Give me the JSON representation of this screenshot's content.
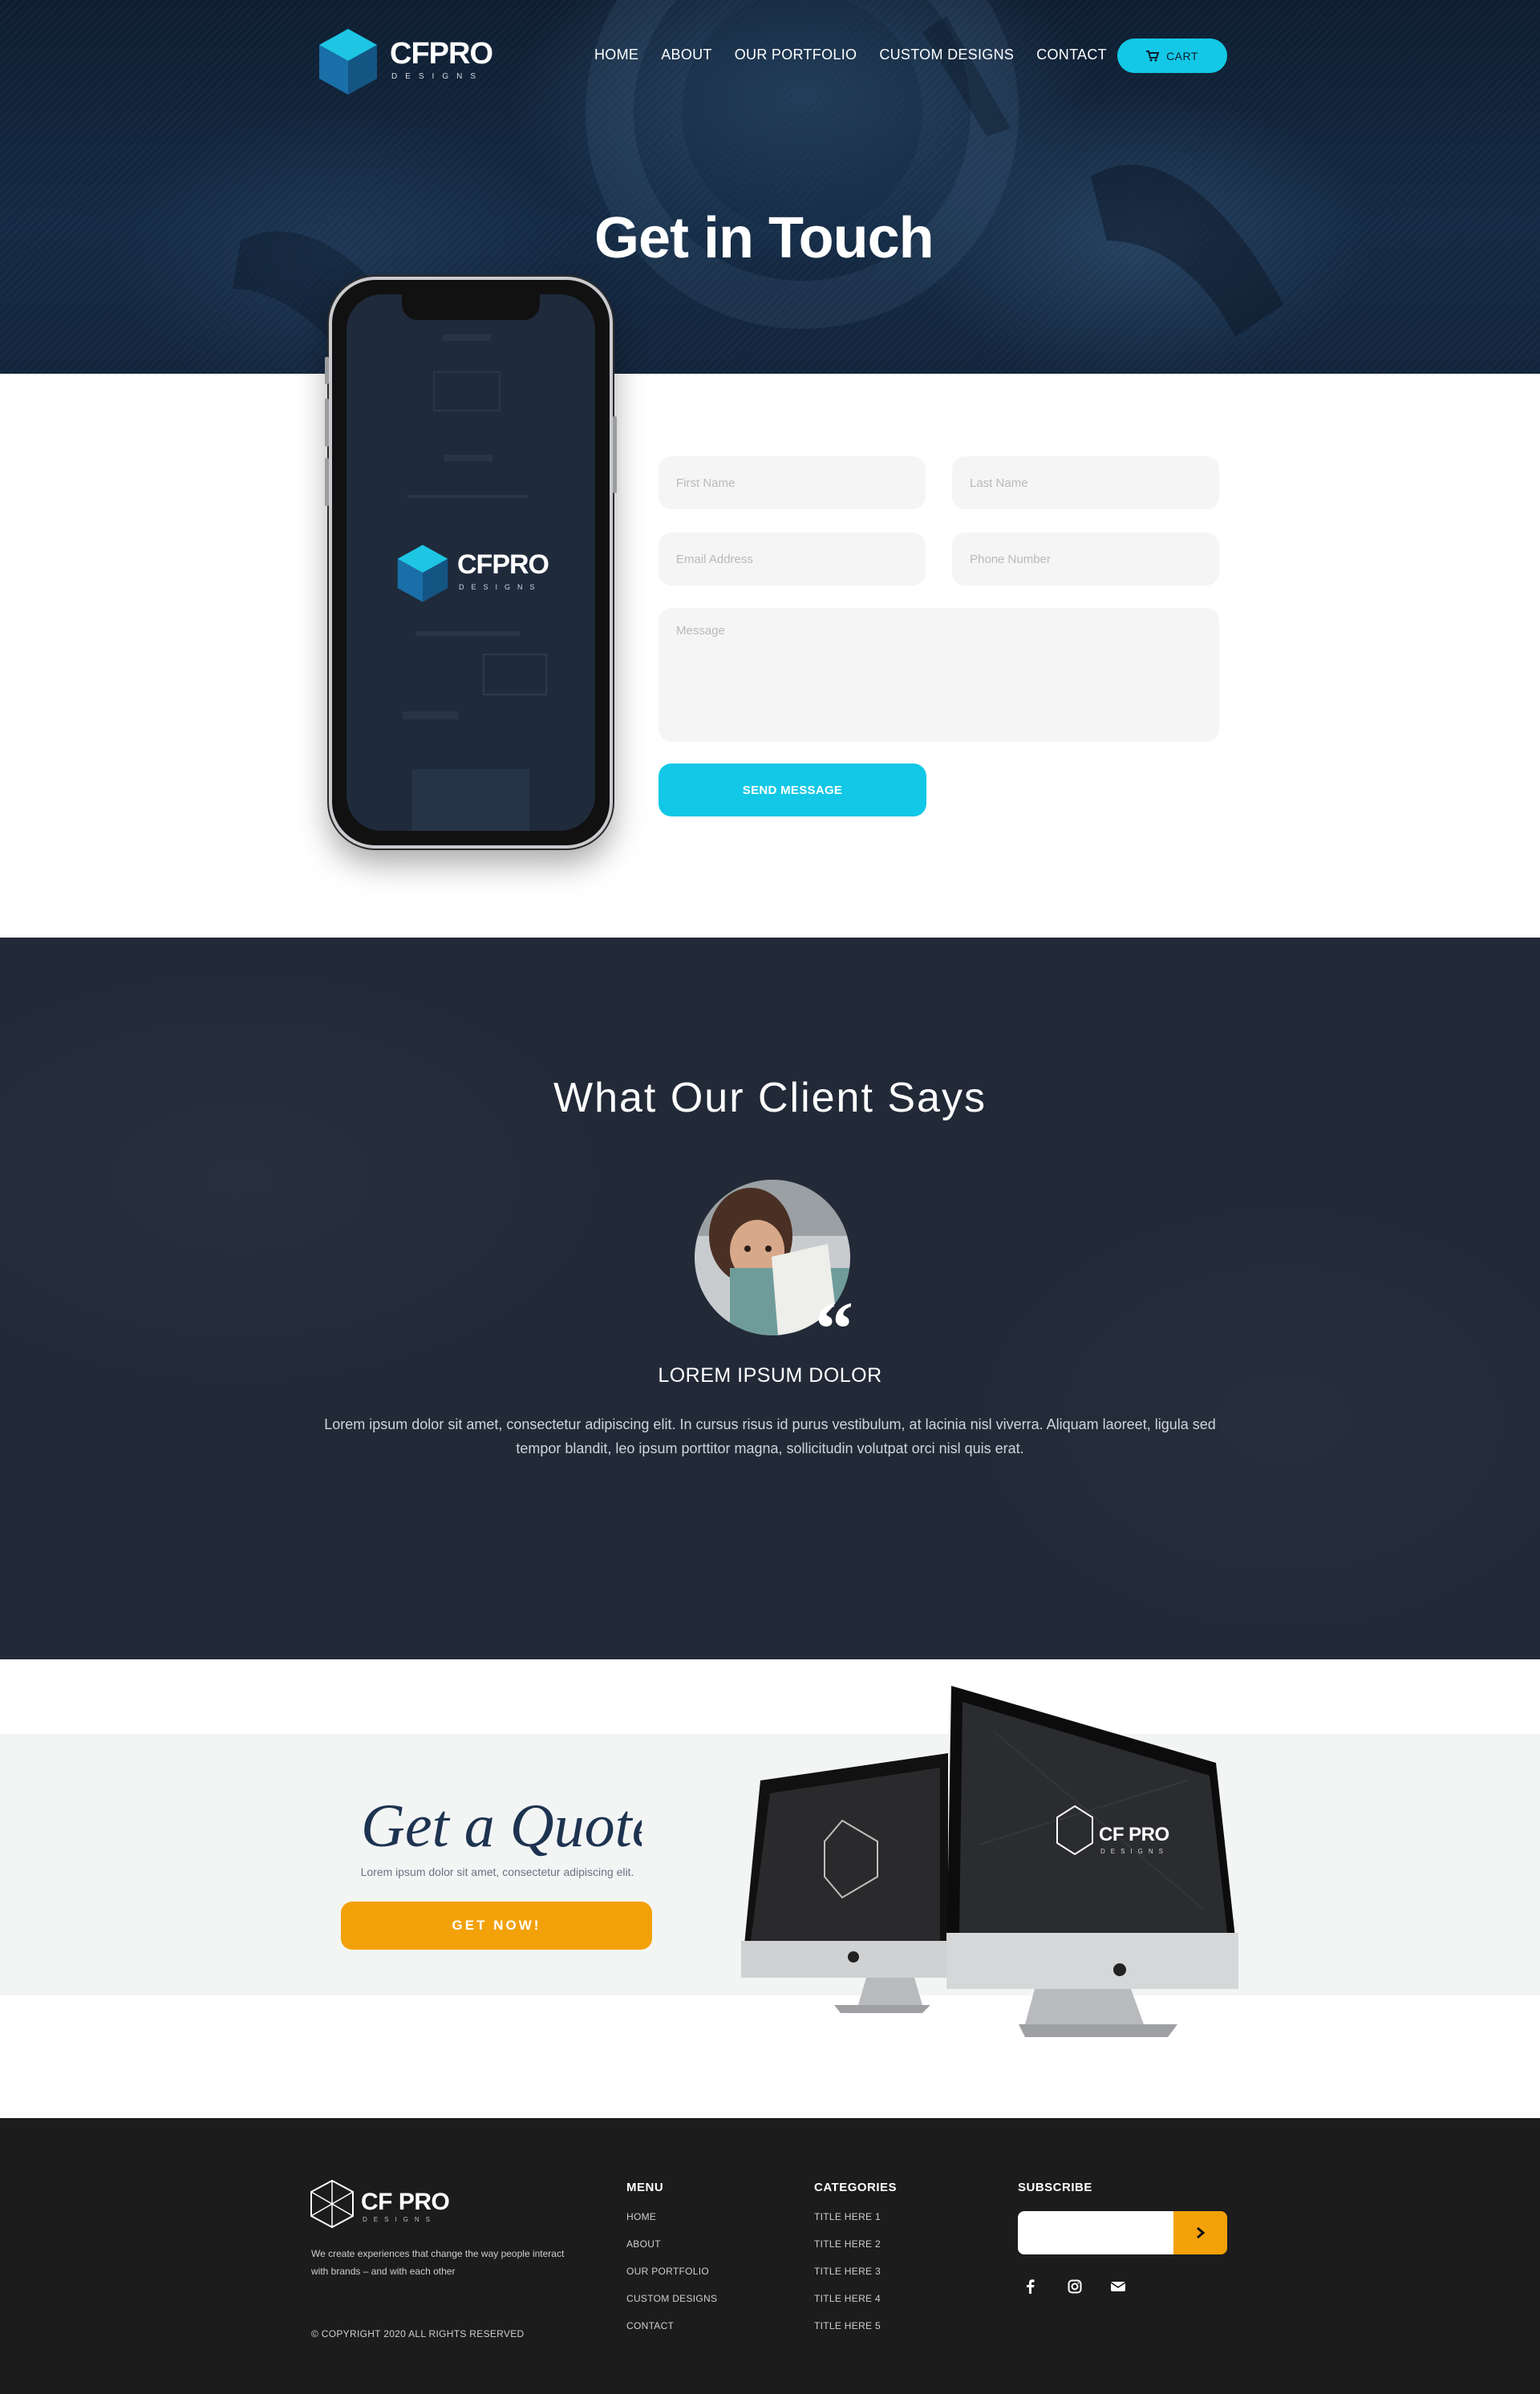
{
  "brand": {
    "name": "CFPRO",
    "tagline": "DESIGNS"
  },
  "nav": {
    "items": [
      {
        "label": "HOME"
      },
      {
        "label": "ABOUT"
      },
      {
        "label": "OUR PORTFOLIO"
      },
      {
        "label": "CUSTOM DESIGNS"
      },
      {
        "label": "CONTACT"
      }
    ],
    "cart_label": "CART"
  },
  "hero": {
    "title": "Get in Touch"
  },
  "form": {
    "first_name_placeholder": "First Name",
    "last_name_placeholder": "Last Name",
    "email_placeholder": "Email Address",
    "phone_placeholder": "Phone Number",
    "message_placeholder": "Message",
    "submit_label": "SEND MESSAGE"
  },
  "testimonial": {
    "title": "What Our Client Says",
    "name": "LOREM IPSUM DOLOR",
    "text": "Lorem ipsum dolor sit amet, consectetur adipiscing elit. In cursus risus id purus vestibulum, at lacinia nisl viverra. Aliquam laoreet, ligula sed tempor blandit, leo ipsum porttitor magna, sollicitudin volutpat orci nisl quis erat."
  },
  "quote": {
    "script_title": "Get a Quote",
    "subtitle": "Lorem ipsum dolor sit amet, consectetur adipiscing elit.",
    "button_label": "GET NOW!",
    "monitor_brand": "CF PRO",
    "monitor_tagline": "DESIGNS"
  },
  "footer": {
    "logo_text": "CF PRO",
    "logo_tagline": "DESIGNS",
    "description": "We create experiences that change the way people interact with brands – and with each other",
    "copyright": "© COPYRIGHT 2020 ALL RIGHTS RESERVED",
    "menu": {
      "heading": "MENU",
      "items": [
        "HOME",
        "ABOUT",
        "OUR PORTFOLIO",
        "CUSTOM DESIGNS",
        "CONTACT"
      ]
    },
    "categories": {
      "heading": "CATEGORIES",
      "items": [
        "TITLE HERE 1",
        "TITLE HERE 2",
        "TITLE HERE 3",
        "TITLE HERE 4",
        "TITLE HERE 5"
      ]
    },
    "subscribe": {
      "heading": "SUBSCRIBE"
    },
    "social": [
      "facebook-icon",
      "instagram-icon",
      "envelope-icon"
    ]
  },
  "colors": {
    "accent_cyan": "#12c8e6",
    "accent_orange": "#f3a108",
    "hero_navy": "#13253c",
    "testimonial_bg": "#222a38",
    "footer_bg": "#1c1c1d",
    "quote_band": "#f3f5f5"
  }
}
